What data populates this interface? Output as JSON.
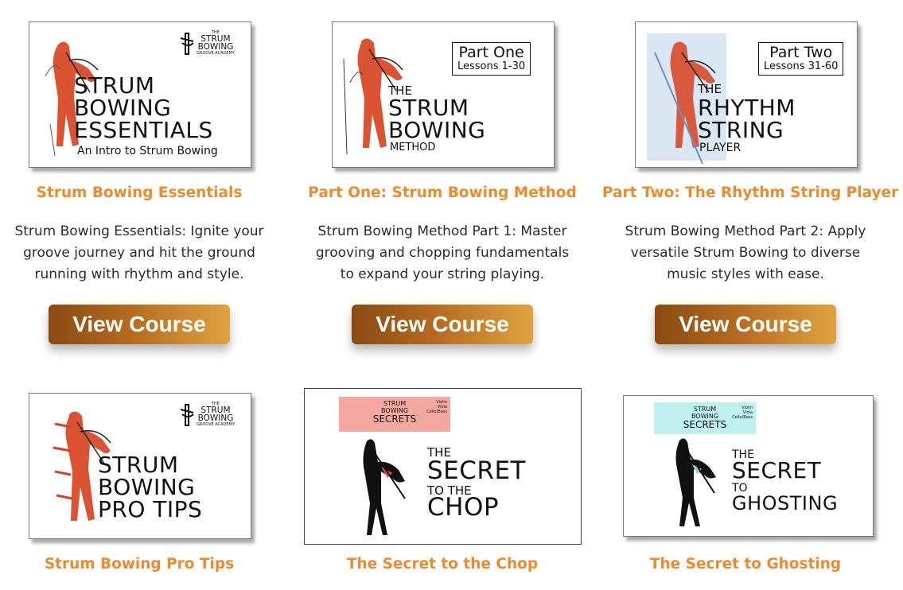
{
  "courses": [
    {
      "title": "Strum Bowing Essentials",
      "description": "Strum Bowing Essentials: Ignite your groove journey and hit the ground running with rhythm and style.",
      "button_label": "View Course",
      "cover": {
        "logo": {
          "the": "THE",
          "line1": "STRUM",
          "line2": "BOWING",
          "sub": "GROOVE ACADEMY"
        },
        "heading": [
          "STRUM",
          "BOWING",
          "ESSENTIALS"
        ],
        "subheading": "An Intro to Strum Bowing"
      }
    },
    {
      "title": "Part One: Strum Bowing Method",
      "description": "Strum Bowing Method Part 1: Master grooving and chopping fundamentals to expand your string playing.",
      "button_label": "View Course",
      "cover": {
        "part_label": "Part One",
        "lessons": "Lessons 1-30",
        "heading_the": "THE",
        "heading": [
          "STRUM",
          "BOWING"
        ],
        "heading_end": "METHOD"
      }
    },
    {
      "title": "Part Two: The Rhythm String Player",
      "description": "Strum Bowing Method Part 2: Apply versatile Strum Bowing to diverse music styles with ease.",
      "button_label": "View Course",
      "cover": {
        "part_label": "Part Two",
        "lessons": "Lessons 31-60",
        "heading_the": "THE",
        "heading": [
          "RHYTHM",
          "STRING"
        ],
        "heading_end": "PLAYER"
      }
    },
    {
      "title": "Strum Bowing Pro Tips",
      "cover": {
        "logo": {
          "the": "THE",
          "line1": "STRUM",
          "line2": "BOWING",
          "sub": "GROOVE ACADEMY"
        },
        "heading": [
          "STRUM",
          "BOWING",
          "PRO TIPS"
        ]
      }
    },
    {
      "title": "The Secret to the Chop",
      "cover": {
        "series": [
          "STRUM",
          "BOWING",
          "SECRETS"
        ],
        "instruments": [
          "Violin",
          "Viola",
          "Cello/Bass"
        ],
        "heading_the": "THE",
        "heading": "SECRET",
        "heading_to": "TO THE",
        "heading_end": "CHOP",
        "accent": "#f5a8a0"
      }
    },
    {
      "title": "The Secret to Ghosting",
      "cover": {
        "series": [
          "STRUM",
          "BOWING",
          "SECRETS"
        ],
        "instruments": [
          "Violin",
          "Viola",
          "Cello/Bass"
        ],
        "heading_the": "THE",
        "heading": "SECRET",
        "heading_to": "TO",
        "heading_end": "GHOSTING",
        "accent": "#bff0f0"
      }
    }
  ],
  "colors": {
    "title": "#ef8a2c",
    "text": "#2b2b2b",
    "button_dark": "#8a4a12",
    "button_light": "#e0a240",
    "figure_red": "#d8401e"
  }
}
